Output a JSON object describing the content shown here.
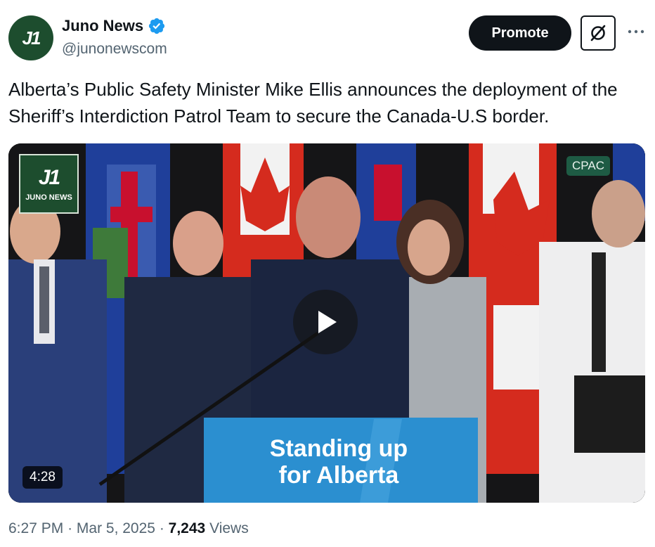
{
  "author": {
    "name": "Juno News",
    "handle": "@junonewscom",
    "avatar_text": "J1",
    "verified_icon": "verified-badge-icon"
  },
  "actions": {
    "promote_label": "Promote",
    "grok_icon": "grok-icon",
    "more_icon": "more-icon"
  },
  "tweet": {
    "text": "Alberta’s Public Safety Minister Mike Ellis announces the deployment of the Sheriff’s Interdiction Patrol Team to secure the Canada-U.S border."
  },
  "video": {
    "watermark_mark": "J1",
    "watermark_text": "JUNO NEWS",
    "channel_badge": "CPAC",
    "duration": "4:28",
    "podium_line1": "Standing up",
    "podium_line2": "for Alberta",
    "play_icon": "play-icon"
  },
  "meta": {
    "time": "6:27 PM",
    "separator": "·",
    "date": "Mar 5, 2025",
    "views_count": "7,243",
    "views_label": "Views"
  },
  "colors": {
    "brand_green": "#1d4d2e",
    "verified_blue": "#1d9bf0",
    "text_primary": "#0f1419",
    "text_secondary": "#536471"
  }
}
